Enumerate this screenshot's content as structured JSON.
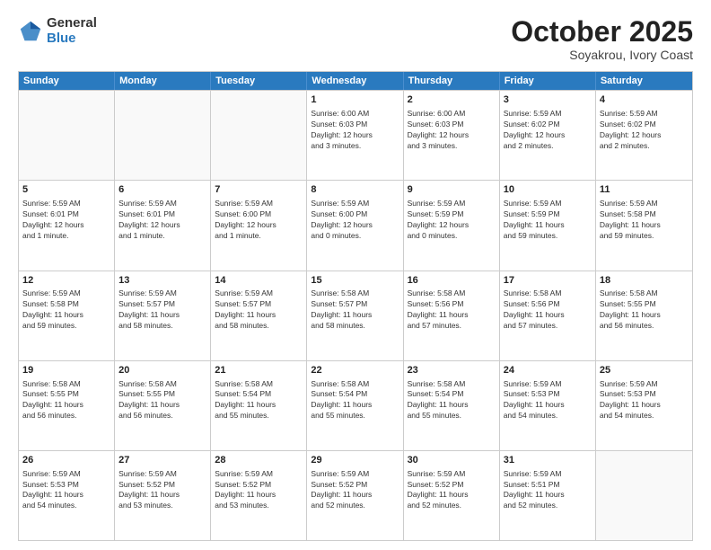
{
  "logo": {
    "general": "General",
    "blue": "Blue"
  },
  "title": "October 2025",
  "subtitle": "Soyakrou, Ivory Coast",
  "days": [
    "Sunday",
    "Monday",
    "Tuesday",
    "Wednesday",
    "Thursday",
    "Friday",
    "Saturday"
  ],
  "rows": [
    [
      {
        "day": "",
        "info": ""
      },
      {
        "day": "",
        "info": ""
      },
      {
        "day": "",
        "info": ""
      },
      {
        "day": "1",
        "info": "Sunrise: 6:00 AM\nSunset: 6:03 PM\nDaylight: 12 hours\nand 3 minutes."
      },
      {
        "day": "2",
        "info": "Sunrise: 6:00 AM\nSunset: 6:03 PM\nDaylight: 12 hours\nand 3 minutes."
      },
      {
        "day": "3",
        "info": "Sunrise: 5:59 AM\nSunset: 6:02 PM\nDaylight: 12 hours\nand 2 minutes."
      },
      {
        "day": "4",
        "info": "Sunrise: 5:59 AM\nSunset: 6:02 PM\nDaylight: 12 hours\nand 2 minutes."
      }
    ],
    [
      {
        "day": "5",
        "info": "Sunrise: 5:59 AM\nSunset: 6:01 PM\nDaylight: 12 hours\nand 1 minute."
      },
      {
        "day": "6",
        "info": "Sunrise: 5:59 AM\nSunset: 6:01 PM\nDaylight: 12 hours\nand 1 minute."
      },
      {
        "day": "7",
        "info": "Sunrise: 5:59 AM\nSunset: 6:00 PM\nDaylight: 12 hours\nand 1 minute."
      },
      {
        "day": "8",
        "info": "Sunrise: 5:59 AM\nSunset: 6:00 PM\nDaylight: 12 hours\nand 0 minutes."
      },
      {
        "day": "9",
        "info": "Sunrise: 5:59 AM\nSunset: 5:59 PM\nDaylight: 12 hours\nand 0 minutes."
      },
      {
        "day": "10",
        "info": "Sunrise: 5:59 AM\nSunset: 5:59 PM\nDaylight: 11 hours\nand 59 minutes."
      },
      {
        "day": "11",
        "info": "Sunrise: 5:59 AM\nSunset: 5:58 PM\nDaylight: 11 hours\nand 59 minutes."
      }
    ],
    [
      {
        "day": "12",
        "info": "Sunrise: 5:59 AM\nSunset: 5:58 PM\nDaylight: 11 hours\nand 59 minutes."
      },
      {
        "day": "13",
        "info": "Sunrise: 5:59 AM\nSunset: 5:57 PM\nDaylight: 11 hours\nand 58 minutes."
      },
      {
        "day": "14",
        "info": "Sunrise: 5:59 AM\nSunset: 5:57 PM\nDaylight: 11 hours\nand 58 minutes."
      },
      {
        "day": "15",
        "info": "Sunrise: 5:58 AM\nSunset: 5:57 PM\nDaylight: 11 hours\nand 58 minutes."
      },
      {
        "day": "16",
        "info": "Sunrise: 5:58 AM\nSunset: 5:56 PM\nDaylight: 11 hours\nand 57 minutes."
      },
      {
        "day": "17",
        "info": "Sunrise: 5:58 AM\nSunset: 5:56 PM\nDaylight: 11 hours\nand 57 minutes."
      },
      {
        "day": "18",
        "info": "Sunrise: 5:58 AM\nSunset: 5:55 PM\nDaylight: 11 hours\nand 56 minutes."
      }
    ],
    [
      {
        "day": "19",
        "info": "Sunrise: 5:58 AM\nSunset: 5:55 PM\nDaylight: 11 hours\nand 56 minutes."
      },
      {
        "day": "20",
        "info": "Sunrise: 5:58 AM\nSunset: 5:55 PM\nDaylight: 11 hours\nand 56 minutes."
      },
      {
        "day": "21",
        "info": "Sunrise: 5:58 AM\nSunset: 5:54 PM\nDaylight: 11 hours\nand 55 minutes."
      },
      {
        "day": "22",
        "info": "Sunrise: 5:58 AM\nSunset: 5:54 PM\nDaylight: 11 hours\nand 55 minutes."
      },
      {
        "day": "23",
        "info": "Sunrise: 5:58 AM\nSunset: 5:54 PM\nDaylight: 11 hours\nand 55 minutes."
      },
      {
        "day": "24",
        "info": "Sunrise: 5:59 AM\nSunset: 5:53 PM\nDaylight: 11 hours\nand 54 minutes."
      },
      {
        "day": "25",
        "info": "Sunrise: 5:59 AM\nSunset: 5:53 PM\nDaylight: 11 hours\nand 54 minutes."
      }
    ],
    [
      {
        "day": "26",
        "info": "Sunrise: 5:59 AM\nSunset: 5:53 PM\nDaylight: 11 hours\nand 54 minutes."
      },
      {
        "day": "27",
        "info": "Sunrise: 5:59 AM\nSunset: 5:52 PM\nDaylight: 11 hours\nand 53 minutes."
      },
      {
        "day": "28",
        "info": "Sunrise: 5:59 AM\nSunset: 5:52 PM\nDaylight: 11 hours\nand 53 minutes."
      },
      {
        "day": "29",
        "info": "Sunrise: 5:59 AM\nSunset: 5:52 PM\nDaylight: 11 hours\nand 52 minutes."
      },
      {
        "day": "30",
        "info": "Sunrise: 5:59 AM\nSunset: 5:52 PM\nDaylight: 11 hours\nand 52 minutes."
      },
      {
        "day": "31",
        "info": "Sunrise: 5:59 AM\nSunset: 5:51 PM\nDaylight: 11 hours\nand 52 minutes."
      },
      {
        "day": "",
        "info": ""
      }
    ]
  ]
}
